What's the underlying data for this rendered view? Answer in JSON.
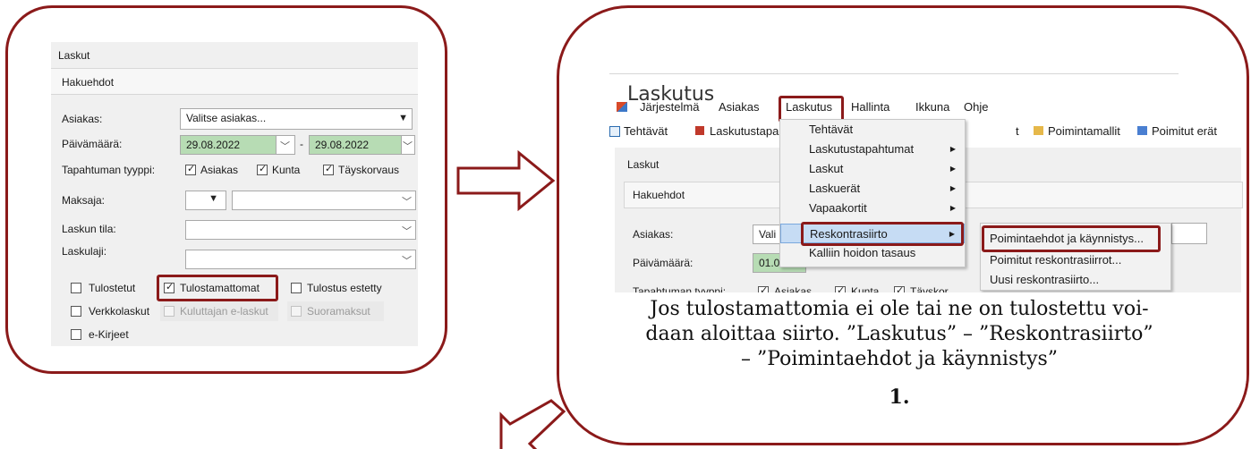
{
  "left_window": {
    "title": "Laskut",
    "section": "Hakuehdot",
    "asiakas_label": "Asiakas:",
    "asiakas_value": "Valitse asiakas...",
    "paivamaara_label": "Päivämäärä:",
    "date_from": "29.08.2022",
    "date_sep": "-",
    "date_to": "29.08.2022",
    "tyyppi_label": "Tapahtuman tyyppi:",
    "tyyppi_options": [
      "Asiakas",
      "Kunta",
      "Täyskorvaus"
    ],
    "maksaja_label": "Maksaja:",
    "laskun_tila_label": "Laskun tila:",
    "laskulaji_label": "Laskulaji:",
    "checkboxes": {
      "tulostetut": "Tulostetut",
      "tulostamattomat": "Tulostamattomat",
      "tulostus_estetty": "Tulostus estetty",
      "verkkolaskut": "Verkkolaskut",
      "kuluttajan_elaskut": "Kuluttajan e-laskut",
      "suoramaksut": "Suoramaksut",
      "ekirjeet": "e-Kirjeet"
    }
  },
  "right_window": {
    "app_title": "Laskutus",
    "menubar": [
      "Järjestelmä",
      "Asiakas",
      "Laskutus",
      "Hallinta",
      "Ikkuna",
      "Ohje"
    ],
    "toolbar": {
      "tehtavat": "Tehtävät",
      "laskutustapa": "Laskutustapa",
      "t": "t",
      "poimintamallit": "Poimintamallit",
      "poimitut_erat": "Poimitut erät"
    },
    "window_title": "Laskut",
    "section": "Hakuehdot",
    "asiakas_label": "Asiakas:",
    "asiakas_value": "Vali",
    "paivamaara_label": "Päivämäärä:",
    "date_partial": "01.0",
    "tyyppi_label": "Tapahtuman tyyppi:",
    "tyyppi_options": [
      "Asiakas",
      "Kunta",
      "Täyskor"
    ],
    "laskutus_menu": [
      "Tehtävät",
      "Laskutustapahtumat",
      "Laskut",
      "Laskuerät",
      "Vapaakortit",
      "Reskontrasiirto",
      "Kalliin hoidon tasaus"
    ],
    "reskontra_submenu": [
      "Poimintaehdot ja käynnistys...",
      "Poimitut reskontrasiirrot...",
      "Uusi reskontrasiirto..."
    ]
  },
  "caption": {
    "line1": "Jos tulostamattomia ei ole tai ne on tulostettu voi-",
    "line2": "daan aloittaa siirto. ”Laskutus” – ”Reskontrasiirto”",
    "line3": "– ”Poimintaehdot ja käynnistys”",
    "step": "1."
  },
  "colors": {
    "frame": "#8b1a1a",
    "date_fill": "#b7dcb4",
    "menu_highlight": "#c6dcf4"
  }
}
